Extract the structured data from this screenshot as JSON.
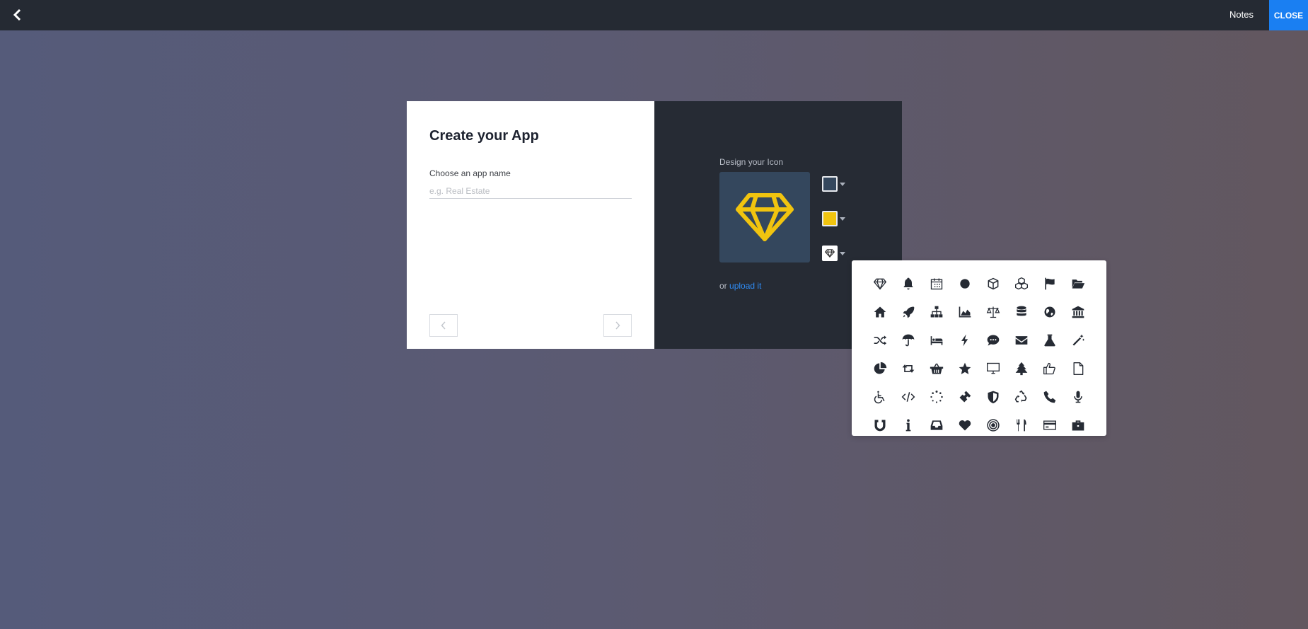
{
  "topbar": {
    "back_icon": "chevron-left-icon",
    "notes_label": "Notes",
    "close_label": "CLOSE"
  },
  "form": {
    "title": "Create your App",
    "name_label": "Choose an app name",
    "name_placeholder": "e.g. Real Estate",
    "name_value": "",
    "prev_icon": "chevron-left-icon",
    "next_icon": "chevron-right-icon"
  },
  "designer": {
    "label": "Design your Icon",
    "selected_icon": "diamond-icon",
    "background_color": "#34475d",
    "foreground_color": "#f1c40f",
    "upload_prefix": "or",
    "upload_link": "upload it"
  },
  "icon_picker": {
    "icons": [
      "diamond-icon",
      "bell-icon",
      "calendar-icon",
      "circle-icon",
      "cube-icon",
      "cubes-icon",
      "flag-icon",
      "folder-open-icon",
      "home-icon",
      "rocket-icon",
      "sitemap-icon",
      "area-chart-icon",
      "balance-scale-icon",
      "database-icon",
      "globe-icon",
      "bank-icon",
      "shuffle-icon",
      "umbrella-icon",
      "bed-icon",
      "bolt-icon",
      "comment-icon",
      "envelope-icon",
      "flask-icon",
      "magic-wand-icon",
      "pie-chart-icon",
      "retweet-icon",
      "shopping-basket-icon",
      "star-icon",
      "desktop-icon",
      "tree-icon",
      "thumbs-up-icon",
      "file-icon",
      "wheelchair-icon",
      "code-icon",
      "spinner-icon",
      "ticket-icon",
      "shield-icon",
      "recycle-icon",
      "phone-icon",
      "microphone-icon",
      "magnet-icon",
      "info-icon",
      "inbox-icon",
      "heart-icon",
      "bullseye-icon",
      "cutlery-icon",
      "credit-card-icon",
      "briefcase-icon"
    ]
  }
}
